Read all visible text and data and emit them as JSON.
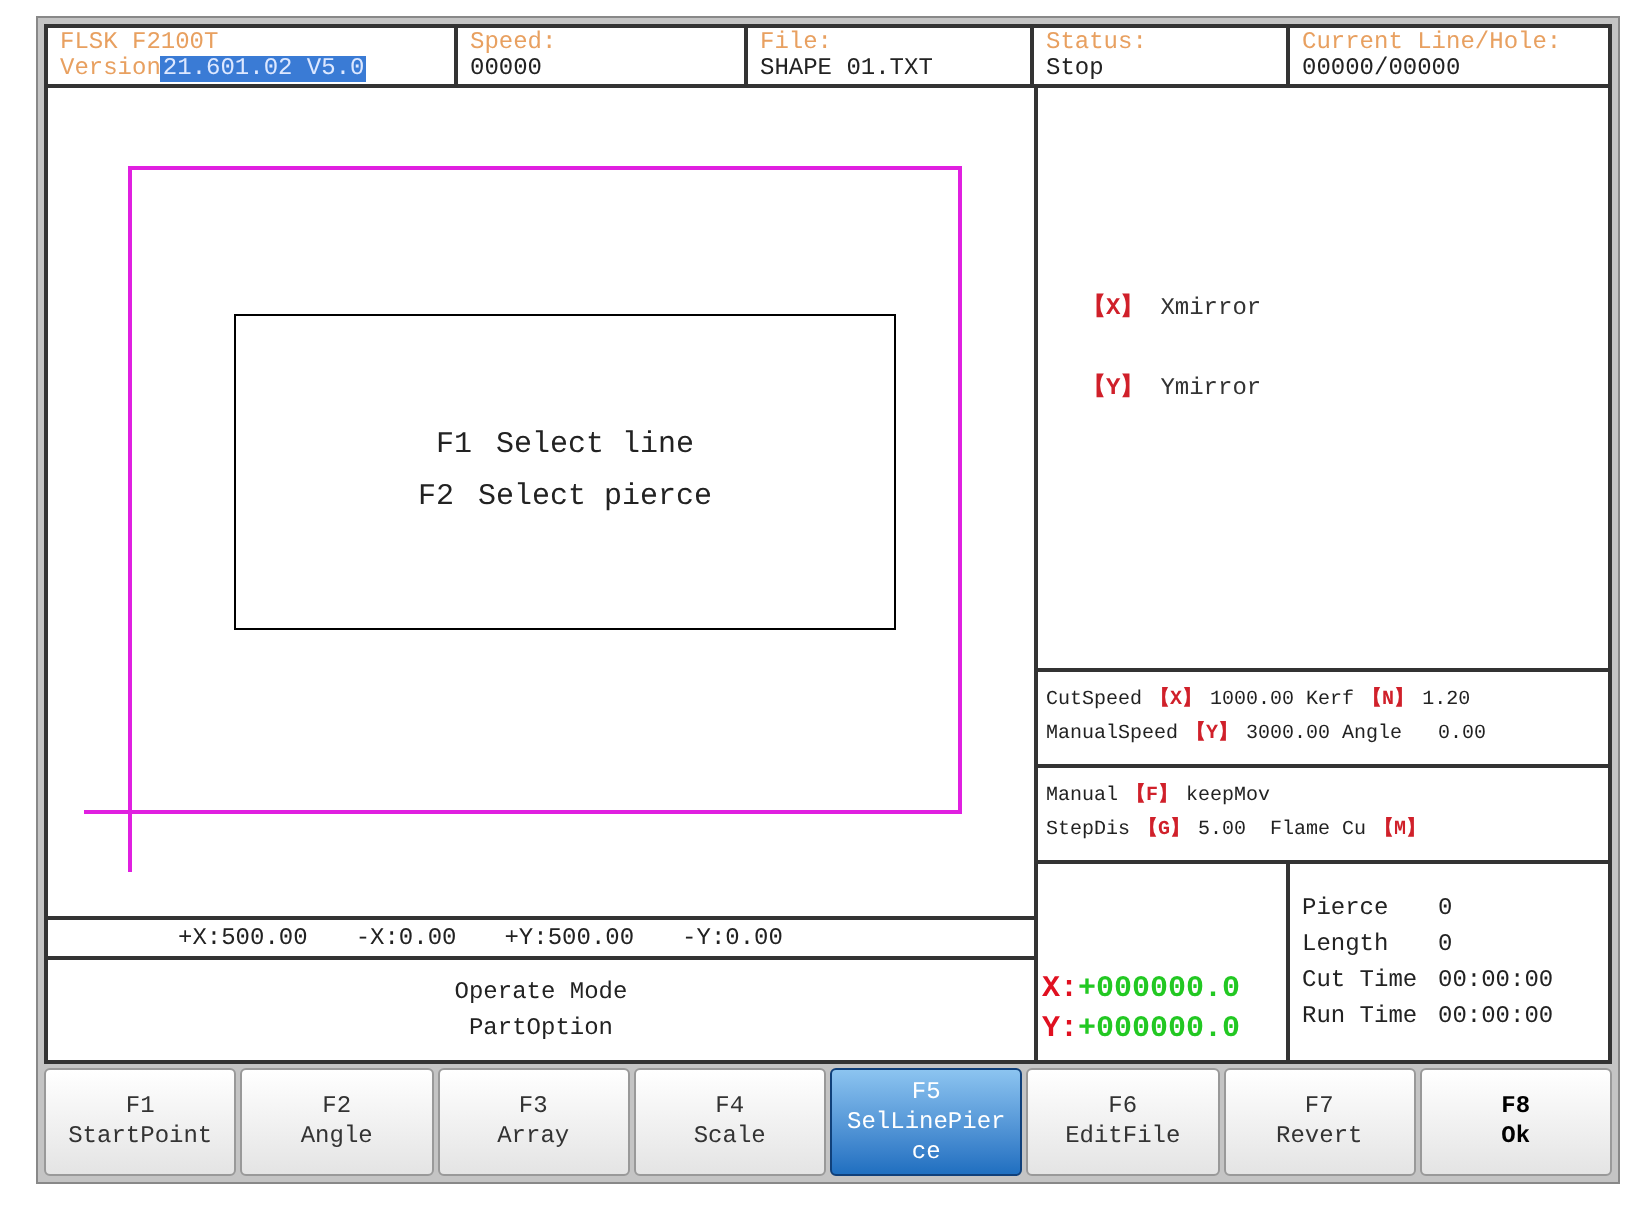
{
  "header": [
    {
      "kind": "version",
      "label": "FLSK F2100T",
      "prefix": "Version",
      "value": "21.601.02 V5.0"
    },
    {
      "kind": "field",
      "label": "Speed:",
      "value": "00000"
    },
    {
      "kind": "field",
      "label": "File:",
      "value": "SHAPE 01.TXT"
    },
    {
      "kind": "field",
      "label": "Status:",
      "value": "Stop"
    },
    {
      "kind": "field",
      "label": "Current Line/Hole:",
      "value": "00000/00000"
    }
  ],
  "dialog": [
    {
      "key": "F1",
      "text": "Select line"
    },
    {
      "key": "F2",
      "text": "Select pierce"
    }
  ],
  "limits": [
    "+X:500.00",
    "-X:0.00",
    "+Y:500.00",
    "-Y:0.00"
  ],
  "mode": [
    "Operate Mode",
    "PartOption"
  ],
  "mirror_options": [
    {
      "key": "【X】",
      "label": "Xmirror"
    },
    {
      "key": "【Y】",
      "label": "Ymirror"
    }
  ],
  "speed_rows": [
    [
      {
        "kind": "text",
        "text": "CutSpeed"
      },
      {
        "kind": "key",
        "text": "【X】"
      },
      {
        "kind": "text",
        "text": "1000.00 Kerf"
      },
      {
        "kind": "key",
        "text": "【N】"
      },
      {
        "kind": "text",
        "text": "1.20"
      }
    ],
    [
      {
        "kind": "text",
        "text": "ManualSpeed"
      },
      {
        "kind": "key",
        "text": "【Y】"
      },
      {
        "kind": "text",
        "text": "3000.00 Angle   0.00"
      }
    ]
  ],
  "manual_rows": [
    [
      {
        "kind": "text",
        "text": "Manual"
      },
      {
        "kind": "key",
        "text": "【F】"
      },
      {
        "kind": "text",
        "text": "keepMov"
      }
    ],
    [
      {
        "kind": "text",
        "text": "StepDis"
      },
      {
        "kind": "key",
        "text": "【G】"
      },
      {
        "kind": "text",
        "text": "5.00  Flame Cu"
      },
      {
        "kind": "key",
        "text": "【M】"
      }
    ]
  ],
  "position": [
    {
      "axis": "X:",
      "value": "+000000.0"
    },
    {
      "axis": "Y:",
      "value": "+000000.0"
    }
  ],
  "stats": [
    {
      "label": "Pierce",
      "value": "0"
    },
    {
      "label": "Length",
      "value": "0"
    },
    {
      "label": "Cut Time",
      "value": "00:00:00"
    },
    {
      "label": "Run Time",
      "value": "00:00:00"
    }
  ],
  "buttons": [
    {
      "key": "F1",
      "label": "StartPoint",
      "selected": false,
      "kind": "normal"
    },
    {
      "key": "F2",
      "label": "Angle",
      "selected": false,
      "kind": "normal"
    },
    {
      "key": "F3",
      "label": "Array",
      "selected": false,
      "kind": "normal"
    },
    {
      "key": "F4",
      "label": "Scale",
      "selected": false,
      "kind": "normal"
    },
    {
      "key": "F5",
      "label": "SelLinePierce",
      "selected": true,
      "kind": "normal"
    },
    {
      "key": "F6",
      "label": "EditFile",
      "selected": false,
      "kind": "normal"
    },
    {
      "key": "F7",
      "label": "Revert",
      "selected": false,
      "kind": "normal"
    },
    {
      "key": "F8",
      "label": "Ok",
      "selected": false,
      "kind": "confirm"
    }
  ]
}
